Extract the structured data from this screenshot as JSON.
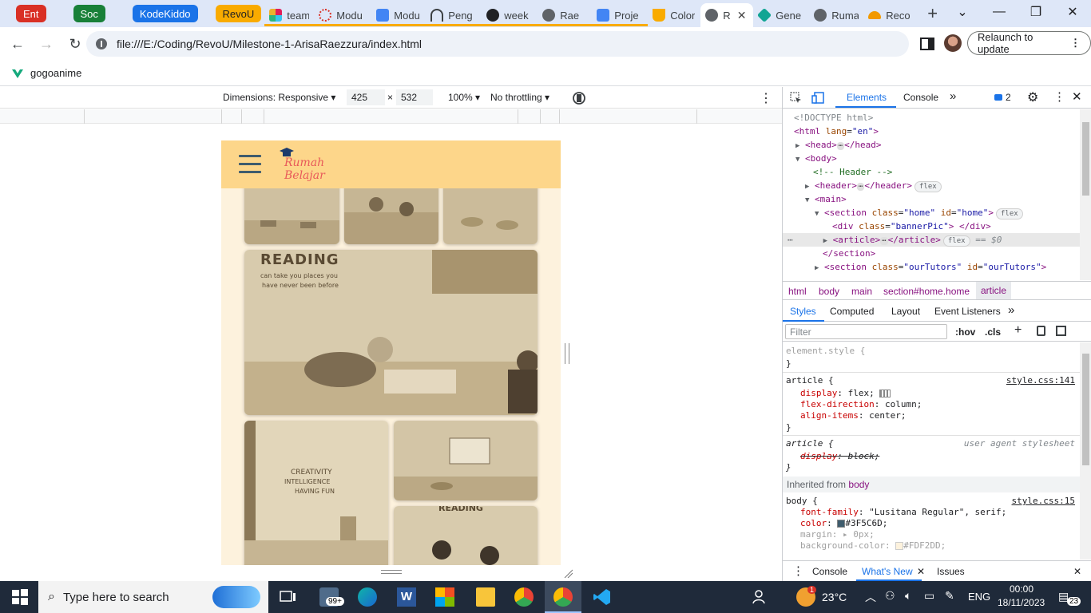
{
  "tabs": [
    {
      "label": "Ent",
      "type": "group",
      "color": "#d93025"
    },
    {
      "label": "Soc",
      "type": "group",
      "color": "#188038"
    },
    {
      "label": "KodeKiddo",
      "type": "group",
      "color": "#1a73e8"
    },
    {
      "label": "RevoU",
      "type": "group",
      "color": "#f9ab00",
      "text_color": "#202124"
    },
    {
      "label": "team",
      "favicon": "slack-icon"
    },
    {
      "label": "Modu",
      "favicon": "circle-dots-icon"
    },
    {
      "label": "Modu",
      "favicon": "docs-icon"
    },
    {
      "label": "Peng",
      "favicon": "headset-icon"
    },
    {
      "label": "week",
      "favicon": "github-icon"
    },
    {
      "label": "Rae",
      "favicon": "globe-icon"
    },
    {
      "label": "Proje",
      "favicon": "docs-icon"
    },
    {
      "label": "Color",
      "favicon": "coffee-icon"
    },
    {
      "label": "R",
      "favicon": "globe-icon",
      "active": true
    },
    {
      "label": "Gene",
      "favicon": "diamond-icon"
    },
    {
      "label": "Ruma",
      "favicon": "globe-icon"
    },
    {
      "label": "Reco",
      "favicon": "shoe-icon"
    }
  ],
  "toolbar": {
    "url": "file:///E:/Coding/RevoU/Milestone-1-ArisaRaezzura/index.html",
    "relaunch_label": "Relaunch to update"
  },
  "bookmarks": [
    {
      "label": "gogoanime"
    }
  ],
  "device_toolbar": {
    "dimensions_label": "Dimensions: Responsive",
    "width": "425",
    "times": "×",
    "height": "532",
    "zoom": "100%",
    "throttling": "No throttling"
  },
  "viewport": {
    "logo_line1": "Rumah",
    "logo_line2": "Belajar",
    "reading_caption": "READING",
    "reading_sub1": "can take you places you",
    "reading_sub2": "have never been before",
    "creativity_caption_1": "CREATIVITY",
    "creativity_caption_2": "INTELLIGENCE",
    "creativity_caption_3": "HAVING FUN",
    "background_color": "#FDF2DD",
    "header_color": "#FDD68A"
  },
  "devtools": {
    "tabs": {
      "elements": "Elements",
      "console": "Console",
      "more": "»",
      "issues_count": "2"
    },
    "dom": [
      {
        "text": "<!DOCTYPE html>"
      },
      {
        "tag_open": "<html",
        "attr": "lang",
        "val": "\"en\"",
        "close": ">"
      },
      {
        "tag": "<head>",
        "tag_close": "</head>"
      },
      {
        "tag": "<body>"
      },
      {
        "comment": "<!-- Header -->"
      },
      {
        "tag": "<header>",
        "tag_close": "</header>",
        "pill": "flex"
      },
      {
        "tag": "<main>"
      },
      {
        "tag_open": "<section",
        "attr1": "class",
        "val1": "\"home\"",
        "attr2": "id",
        "val2": "\"home\"",
        "close": ">",
        "pill": "flex"
      },
      {
        "tag_open": "<div",
        "attr": "class",
        "val": "\"bannerPic\"",
        "close": "> </div>"
      },
      {
        "tag": "<article>",
        "tag_close": "</article>",
        "pill": "flex",
        "eq": "== $0"
      },
      {
        "tag": "</section>"
      },
      {
        "tag_open": "<section",
        "attr1": "class",
        "val1": "\"ourTutors\"",
        "attr2": "id",
        "val2": "\"ourTutors\"",
        "close": ">"
      }
    ],
    "breadcrumbs": [
      "html",
      "body",
      "main",
      "section#home.home",
      "article"
    ],
    "styles_tabs": [
      "Styles",
      "Computed",
      "Layout",
      "Event Listeners",
      "»"
    ],
    "filter_placeholder": "Filter",
    "filter_buttons": {
      "hov": ":hov",
      "cls": ".cls"
    },
    "rules": {
      "element_style": "element.style {",
      "close": "}",
      "article_selector": "article {",
      "article_src": "style.css:141",
      "article_props": [
        {
          "p": "display",
          "v": "flex;"
        },
        {
          "p": "flex-direction",
          "v": "column;"
        },
        {
          "p": "align-items",
          "v": "center;"
        }
      ],
      "ua_selector": "article {",
      "ua_src": "user agent stylesheet",
      "ua_prop": {
        "p": "display",
        "v": "block;"
      },
      "inherited_label": "Inherited from",
      "inherited_from": "body",
      "body_selector": "body {",
      "body_src": "style.css:15",
      "body_props": [
        {
          "p": "font-family",
          "v": "\"Lusitana Regular\", serif;"
        },
        {
          "p": "color",
          "v": "#3F5C6D;",
          "swatch": "#3F5C6D"
        },
        {
          "p": "margin",
          "v": "0px;"
        },
        {
          "p": "background-color",
          "v": "#FDF2DD;",
          "swatch": "#FDF2DD"
        }
      ]
    },
    "drawer": {
      "console": "Console",
      "whats_new": "What's New",
      "issues": "Issues"
    }
  },
  "taskbar": {
    "search_placeholder": "Type here to search",
    "badge": "99+",
    "weather_temp": "23°C",
    "weather_alert": "1",
    "lang": "ENG",
    "time": "00:00",
    "date": "18/11/2023",
    "notif_count": "23"
  }
}
